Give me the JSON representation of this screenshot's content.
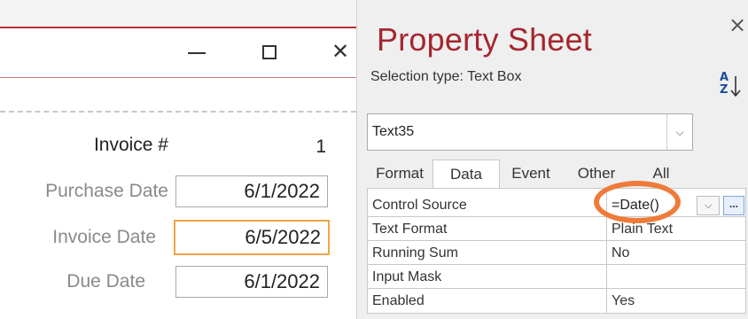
{
  "form": {
    "invoice_number_label": "Invoice #",
    "invoice_number_value": "1",
    "purchase_date_label": "Purchase Date",
    "purchase_date_value": "6/1/2022",
    "invoice_date_label": "Invoice Date",
    "invoice_date_value": "6/5/2022",
    "due_date_label": "Due Date",
    "due_date_value": "6/1/2022"
  },
  "window_controls": {
    "minimize_icon": "minimize-icon",
    "maximize_icon": "maximize-icon",
    "close_glyph": "✕"
  },
  "property_sheet": {
    "title": "Property Sheet",
    "close_glyph": "×",
    "selection_type": "Selection type:  Text Box",
    "selector_value": "Text35",
    "tabs": [
      {
        "label": "Format"
      },
      {
        "label": "Data"
      },
      {
        "label": "Event"
      },
      {
        "label": "Other"
      },
      {
        "label": "All"
      }
    ],
    "active_tab": "Data",
    "rows": [
      {
        "name": "Control Source",
        "value": "=Date()"
      },
      {
        "name": "Text Format",
        "value": "Plain Text"
      },
      {
        "name": "Running Sum",
        "value": "No"
      },
      {
        "name": "Input Mask",
        "value": ""
      },
      {
        "name": "Enabled",
        "value": "Yes"
      }
    ],
    "builder_label": "..."
  },
  "colors": {
    "title_red": "#a5262f",
    "highlight_orange": "#ef7b3a",
    "focus_border": "#f0a447"
  }
}
